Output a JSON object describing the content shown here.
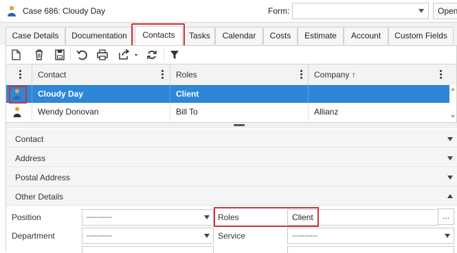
{
  "title_bar": {
    "case_title": "Case 686: Cloudy Day",
    "form_label": "Form:",
    "form_value": "",
    "open_button": "Open"
  },
  "tabs": [
    {
      "label": "Case Details"
    },
    {
      "label": "Documentation"
    },
    {
      "label": "Contacts",
      "active": true
    },
    {
      "label": "Tasks"
    },
    {
      "label": "Calendar"
    },
    {
      "label": "Costs"
    },
    {
      "label": "Estimate"
    },
    {
      "label": "Account"
    },
    {
      "label": "Custom Fields"
    }
  ],
  "toolbar": {
    "buttons": [
      "new-icon",
      "delete-icon",
      "save-icon",
      "undo-icon",
      "print-icon",
      "export-icon",
      "refresh-icon",
      "filter-icon"
    ]
  },
  "grid": {
    "columns": {
      "contact": "Contact",
      "roles": "Roles",
      "company": "Company ↑"
    },
    "rows": [
      {
        "contact": "Cloudy Day",
        "roles": "Client",
        "company": ""
      },
      {
        "contact": "Wendy Donovan",
        "roles": "Bill To",
        "company": "Allianz"
      }
    ]
  },
  "sections": {
    "contact": "Contact",
    "address": "Address",
    "postal_address": "Postal Address",
    "other_details": "Other Details"
  },
  "fields": {
    "position_label": "Position",
    "position_value": "----------",
    "department_label": "Department",
    "department_value": "----------",
    "roles_label": "Roles",
    "roles_value": "Client",
    "service_label": "Service",
    "service_value": "----------",
    "ellipsis": "..."
  },
  "colors": {
    "selection": "#2e86d6",
    "highlight": "#cc3333"
  }
}
